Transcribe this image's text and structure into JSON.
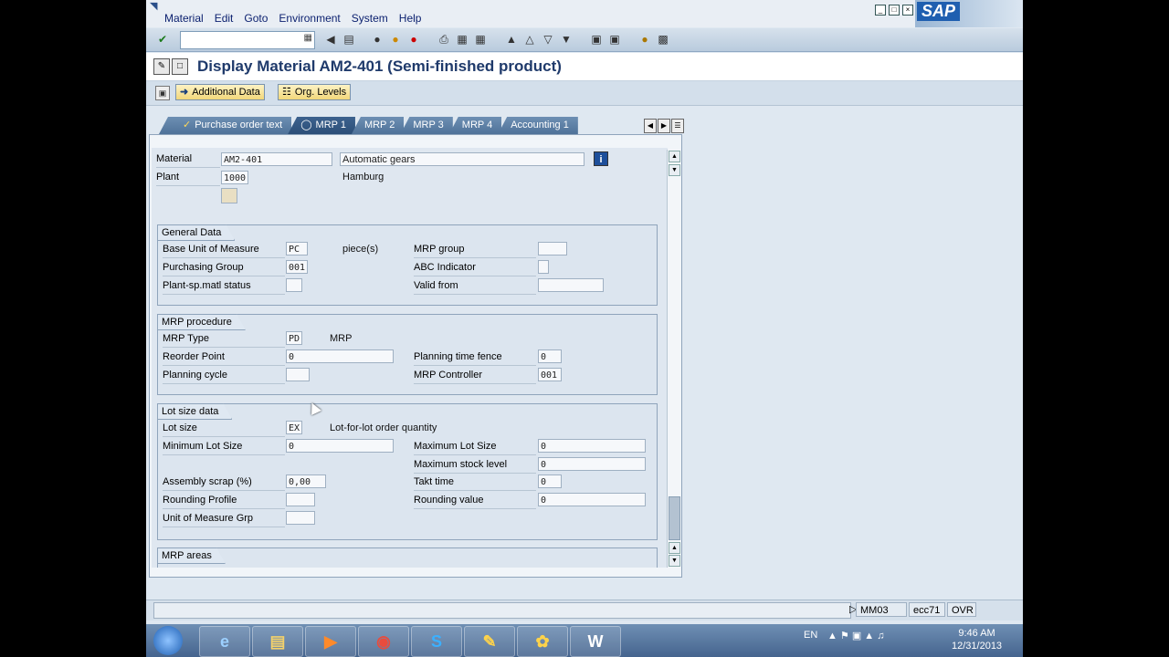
{
  "menubar": {
    "items": [
      "Material",
      "Edit",
      "Goto",
      "Environment",
      "System",
      "Help"
    ]
  },
  "brand": "SAP",
  "title": "Display Material AM2-401 (Semi-finished product)",
  "app_toolbar": {
    "additional_data": "Additional Data",
    "org_levels": "Org. Levels"
  },
  "tabs": [
    "Purchase order text",
    "MRP 1",
    "MRP 2",
    "MRP 3",
    "MRP 4",
    "Accounting 1"
  ],
  "active_tab": "MRP 1",
  "header": {
    "material_label": "Material",
    "material_value": "AM2-401",
    "material_desc": "Automatic gears",
    "plant_label": "Plant",
    "plant_value": "1000",
    "plant_desc": "Hamburg"
  },
  "general_data": {
    "title": "General Data",
    "base_uom_label": "Base Unit of Measure",
    "base_uom_value": "PC",
    "base_uom_text": "piece(s)",
    "purch_group_label": "Purchasing Group",
    "purch_group_value": "001",
    "plant_status_label": "Plant-sp.matl status",
    "plant_status_value": "",
    "mrp_group_label": "MRP group",
    "mrp_group_value": "",
    "abc_label": "ABC Indicator",
    "abc_value": "",
    "valid_from_label": "Valid from",
    "valid_from_value": ""
  },
  "mrp_procedure": {
    "title": "MRP procedure",
    "mrp_type_label": "MRP Type",
    "mrp_type_value": "PD",
    "mrp_type_text": "MRP",
    "reorder_label": "Reorder Point",
    "reorder_value": "0",
    "planning_cycle_label": "Planning cycle",
    "planning_cycle_value": "",
    "ptf_label": "Planning time fence",
    "ptf_value": "0",
    "controller_label": "MRP Controller",
    "controller_value": "001"
  },
  "lot_size": {
    "title": "Lot size data",
    "lot_size_label": "Lot size",
    "lot_size_value": "EX",
    "lot_size_text": "Lot-for-lot order quantity",
    "min_label": "Minimum Lot Size",
    "min_value": "0",
    "max_label": "Maximum Lot Size",
    "max_value": "0",
    "max_stock_label": "Maximum stock level",
    "max_stock_value": "0",
    "scrap_label": "Assembly scrap (%)",
    "scrap_value": "0,00",
    "takt_label": "Takt time",
    "takt_value": "0",
    "rounding_profile_label": "Rounding Profile",
    "rounding_profile_value": "",
    "rounding_value_label": "Rounding value",
    "rounding_value_value": "0",
    "uom_grp_label": "Unit of Measure Grp",
    "uom_grp_value": ""
  },
  "mrp_areas": {
    "title": "MRP areas"
  },
  "status": {
    "tcode": "MM03",
    "system": "ecc71",
    "mode": "OVR"
  },
  "taskbar": {
    "lang": "EN",
    "time": "9:46 AM",
    "date": "12/31/2013"
  }
}
